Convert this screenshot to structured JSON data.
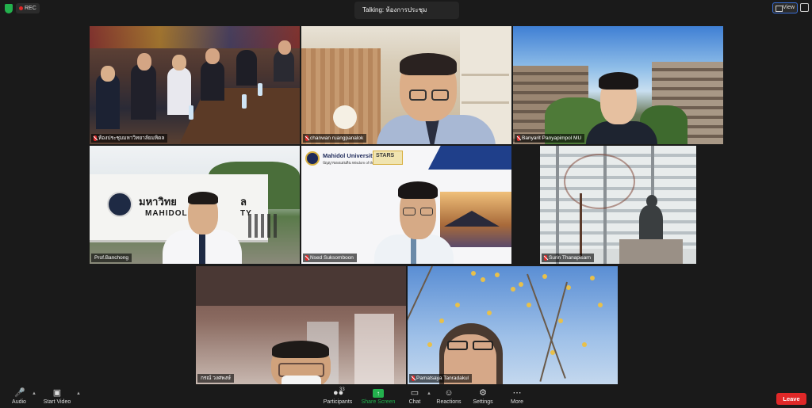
{
  "top_bar": {
    "rec_label": "REC",
    "talking_label": "Talking: ห้องการประชุม",
    "view_label": "View"
  },
  "participants": [
    {
      "name": "ห้องประชุมมหาวิทยาลัยมหิดล"
    },
    {
      "name": "chanwan ruangpanalok"
    },
    {
      "name": "Banyarit Panyapimpol MU"
    },
    {
      "name": "Prof.Banchong"
    },
    {
      "name": "Nsed Suksomboon"
    },
    {
      "name": "Surin Thanapisarn"
    },
    {
      "name": "กรณ์ วงศพงษ์"
    },
    {
      "name": "Pamatsaya Tanradakul"
    }
  ],
  "scene_text": {
    "building_sign_th": "มหาวิทย",
    "building_sign_th2": "ล",
    "building_sign_en": "MAHIDOL",
    "building_sign_en2": "TY",
    "slide_university": "Mahidol University",
    "slide_tagline": "ปัญญาของแผ่นดิน Wisdom of the Land",
    "slide_logo": "STARS"
  },
  "toolbar": {
    "audio_label": "Audio",
    "start_video_label": "Start Video",
    "participants_label": "Participants",
    "participants_count": "33",
    "share_screen_label": "Share Screen",
    "chat_label": "Chat",
    "reactions_label": "Reactions",
    "settings_label": "Settings",
    "more_label": "More",
    "leave_label": "Leave"
  },
  "colors": {
    "accent_green": "#23b14d",
    "leave_red": "#e02828",
    "view_border": "#3a6fd8"
  }
}
